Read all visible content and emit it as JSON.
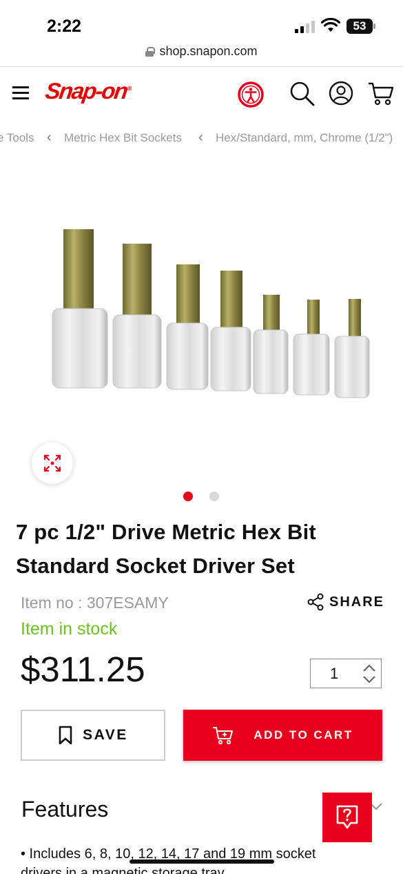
{
  "status_bar": {
    "time": "2:22",
    "battery": "53"
  },
  "browser": {
    "url": "shop.snapon.com"
  },
  "header": {
    "logo_text": "Snap-on",
    "logo_reg": "®",
    "brand_color": "#e60000",
    "icons": [
      "menu-icon",
      "accessibility-icon",
      "search-icon",
      "user-icon",
      "cart-icon"
    ]
  },
  "breadcrumb": {
    "items": [
      "e Tools",
      "Metric Hex Bit Sockets",
      "Hex/Standard, mm, Chrome (1/2\")"
    ]
  },
  "gallery": {
    "slides": 2,
    "active_slide": 1,
    "active_color": "#e8001c",
    "inactive_color": "#d9d9d9"
  },
  "product": {
    "title_line1": "7 pc 1/2\" Drive Metric Hex Bit",
    "title_line2": "Standard Socket Driver Set",
    "item_no": "Item no : 307ESAMY",
    "share_label": "SHARE",
    "stock_status": "Item in stock",
    "stock_color": "#6cc024",
    "price": "$311.25",
    "quantity": "1",
    "save_label": "SAVE",
    "add_to_cart_label": "ADD TO CART",
    "cta_color": "#e8001c"
  },
  "features": {
    "title": "Features",
    "bullet_1": "• Includes 6, 8, 10, 12, 14, 17 and 19 mm socket",
    "bullet_1_cont": "drivers in a magnetic storage tray"
  }
}
